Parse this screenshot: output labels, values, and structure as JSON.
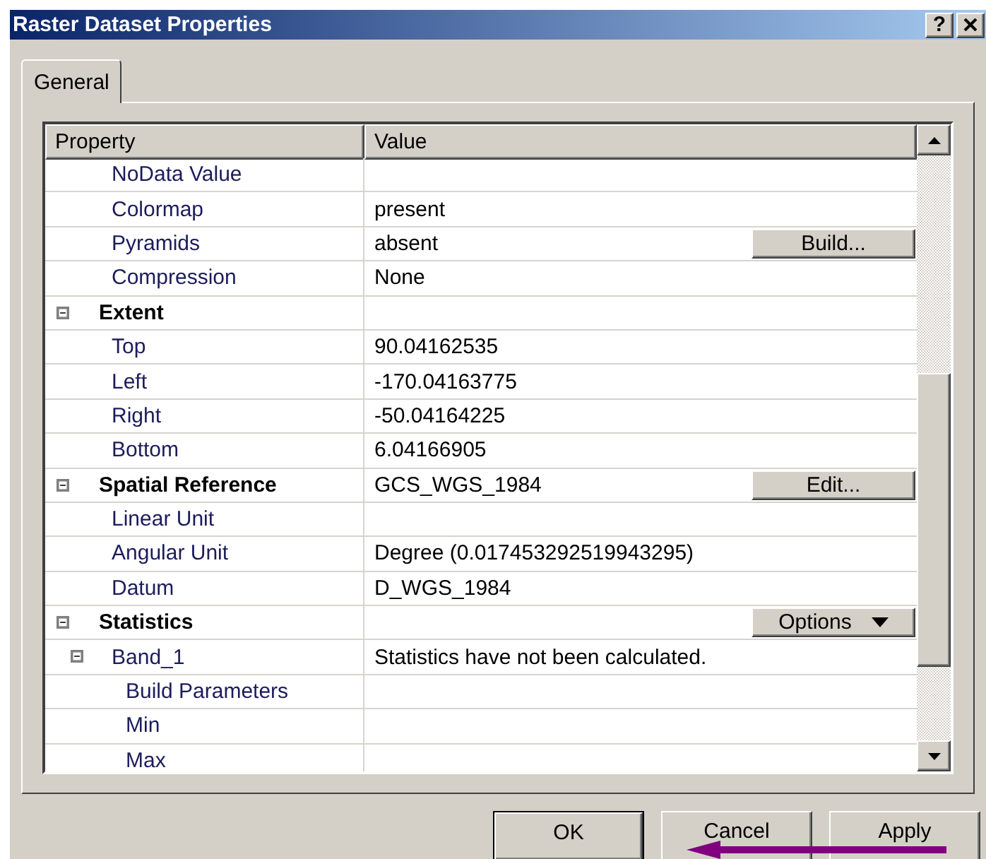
{
  "window": {
    "title": "Raster Dataset Properties",
    "help_button": "?"
  },
  "tabs": [
    {
      "label": "General",
      "selected": true
    }
  ],
  "grid": {
    "columns": [
      "Property",
      "Value"
    ],
    "rows": [
      {
        "kind": "item",
        "label": "NoData Value"
      },
      {
        "kind": "item",
        "label": "Colormap",
        "value": "present"
      },
      {
        "kind": "item",
        "label": "Pyramids",
        "value": "absent",
        "button": {
          "kind": "plain",
          "label": "Build..."
        }
      },
      {
        "kind": "item",
        "label": "Compression",
        "value": "None"
      },
      {
        "kind": "group",
        "label": "Extent",
        "expanded": true,
        "children": [
          {
            "kind": "item",
            "label": "Top",
            "value": "90.04162535"
          },
          {
            "kind": "item",
            "label": "Left",
            "value": "-170.04163775"
          },
          {
            "kind": "item",
            "label": "Right",
            "value": "-50.04164225"
          },
          {
            "kind": "item",
            "label": "Bottom",
            "value": "6.04166905"
          }
        ]
      },
      {
        "kind": "group",
        "label": "Spatial Reference",
        "value": "GCS_WGS_1984",
        "button": {
          "kind": "plain",
          "label": "Edit..."
        },
        "expanded": true,
        "children": [
          {
            "kind": "item",
            "label": "Linear Unit"
          },
          {
            "kind": "item",
            "label": "Angular Unit",
            "value": "Degree (0.017453292519943295)"
          },
          {
            "kind": "item",
            "label": "Datum",
            "value": "D_WGS_1984"
          }
        ]
      },
      {
        "kind": "group",
        "label": "Statistics",
        "button": {
          "kind": "dropdown",
          "label": "Options"
        },
        "expanded": true,
        "children": [
          {
            "kind": "group",
            "label": "Band_1",
            "value": "Statistics have not been calculated.",
            "expanded": true,
            "children": [
              {
                "kind": "item",
                "label": "Build Parameters"
              },
              {
                "kind": "item",
                "label": "Min"
              },
              {
                "kind": "item",
                "label": "Max"
              }
            ]
          }
        ]
      }
    ]
  },
  "buttons": [
    {
      "label": "OK",
      "default": true
    },
    {
      "label": "Cancel",
      "default": false
    },
    {
      "label": "Apply",
      "default": false
    }
  ]
}
